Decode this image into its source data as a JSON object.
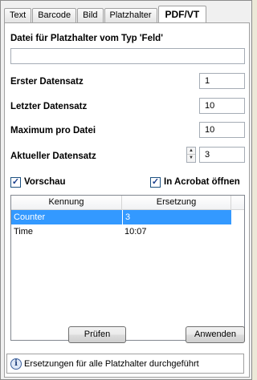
{
  "tabs": [
    {
      "label": "Text"
    },
    {
      "label": "Barcode"
    },
    {
      "label": "Bild"
    },
    {
      "label": "Platzhalter"
    },
    {
      "label": "PDF/VT",
      "active": true
    }
  ],
  "form": {
    "field_type_label": "Datei für Platzhalter vom Typ 'Feld'",
    "field_type_value": "",
    "first_record_label": "Erster Datensatz",
    "first_record_value": "1",
    "last_record_label": "Letzter Datensatz",
    "last_record_value": "10",
    "max_per_file_label": "Maximum pro Datei",
    "max_per_file_value": "10",
    "current_record_label": "Aktueller Datensatz",
    "current_record_value": "3",
    "preview_label": "Vorschau",
    "preview_checked": true,
    "open_acrobat_label": "In Acrobat öffnen",
    "open_acrobat_checked": true
  },
  "table": {
    "columns": [
      "Kennung",
      "Ersetzung"
    ],
    "rows": [
      {
        "key": "Counter",
        "value": "3",
        "selected": true
      },
      {
        "key": "Time",
        "value": "10:07",
        "selected": false
      }
    ]
  },
  "buttons": {
    "check_label": "Prüfen",
    "apply_label": "Anwenden"
  },
  "status": {
    "icon": "info-icon",
    "message": "Ersetzungen für alle Platzhalter durchgeführt"
  },
  "colors": {
    "selection": "#3399ff",
    "checkmark": "#1a3e8c"
  }
}
